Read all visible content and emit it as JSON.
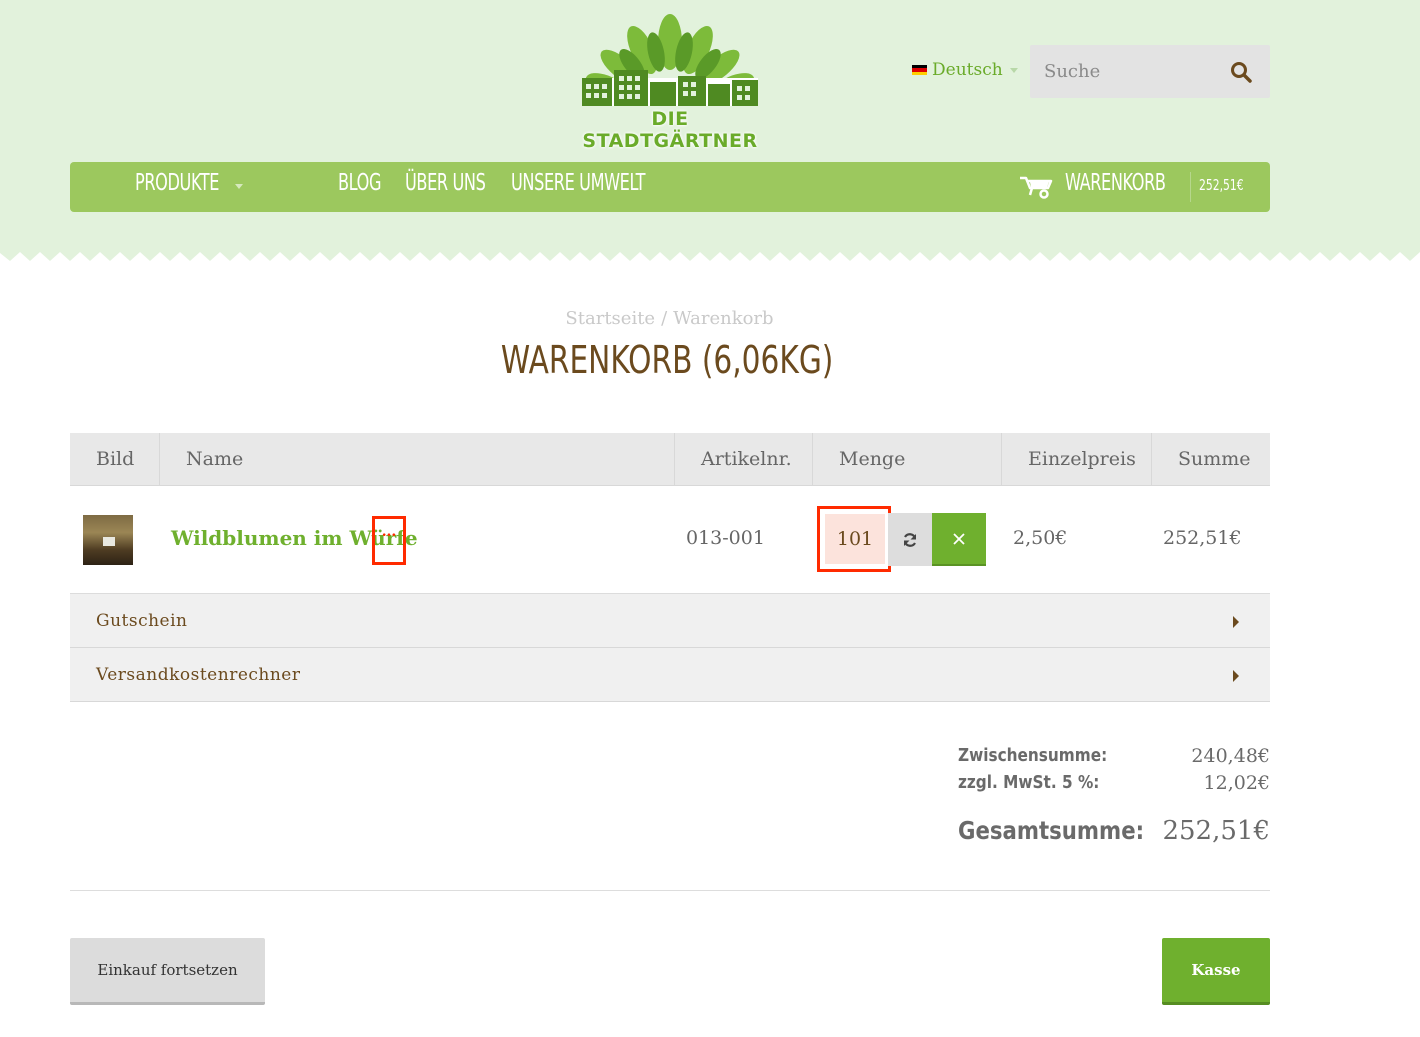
{
  "brand": {
    "logo_text": "DIE STADTGÄRTNER",
    "accent_color": "#6fb02e",
    "nav_color": "#9cc85e",
    "title_color": "#6b4a1e"
  },
  "header": {
    "language": {
      "label": "Deutsch",
      "flag": "germany-flag-icon"
    },
    "search": {
      "placeholder": "Suche",
      "icon": "search-icon"
    }
  },
  "nav": {
    "items": [
      {
        "label": "Produkte"
      },
      {
        "label": "Blog"
      },
      {
        "label": "Über uns"
      },
      {
        "label": "Unsere Umwelt"
      }
    ],
    "cart_label": "Warenkorb",
    "cart_total": "252,51€"
  },
  "breadcrumb": {
    "home": "Startseite",
    "separator": "/",
    "current": "Warenkorb"
  },
  "page_title": "Warenkorb (6,06kg)",
  "cart_table": {
    "headers": {
      "image": "Bild",
      "name": "Name",
      "sku": "Artikelnr.",
      "qty": "Menge",
      "unit_price": "Einzelpreis",
      "total": "Summe"
    },
    "items": [
      {
        "name": "Wildblumen im Würfe",
        "more": "...",
        "sku": "013-001",
        "qty": "101",
        "unit_price": "2,50€",
        "total": "252,51€"
      }
    ],
    "remove_symbol": "×"
  },
  "accordions": [
    {
      "label": "Gutschein"
    },
    {
      "label": "Versandkostenrechner"
    }
  ],
  "totals": {
    "subtotal_label": "Zwischensumme:",
    "subtotal": "240,48€",
    "tax_label": "zzgl. MwSt. 5 %:",
    "tax": "12,02€",
    "grand_label": "Gesamtsumme:",
    "grand": "252,51€"
  },
  "actions": {
    "continue_label": "Einkauf fortsetzen",
    "checkout_label": "Kasse"
  }
}
